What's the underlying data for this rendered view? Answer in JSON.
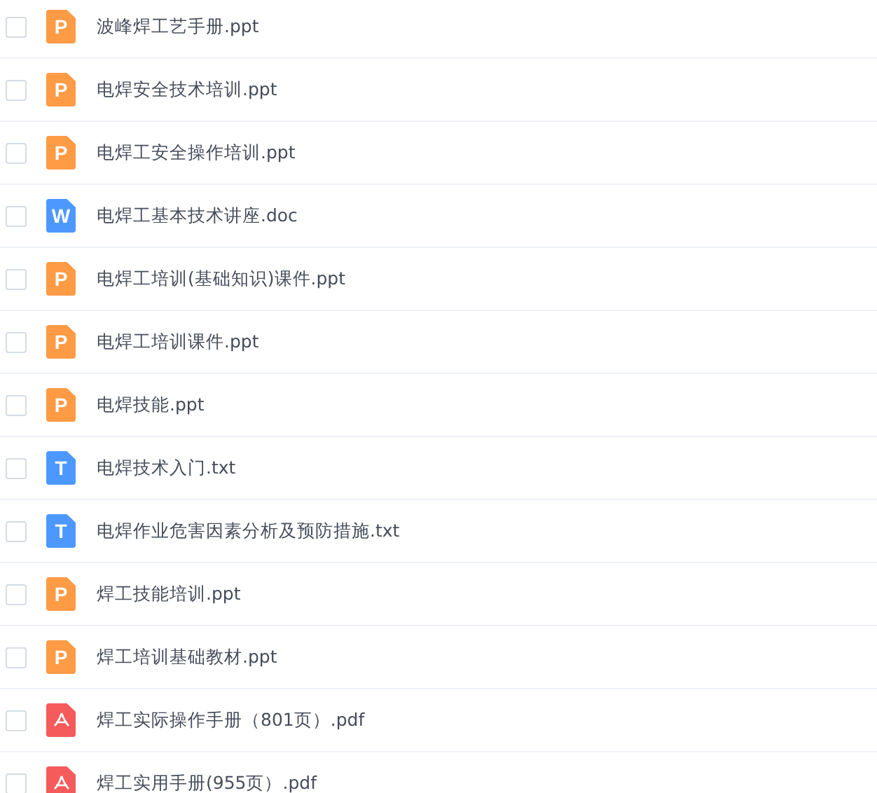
{
  "files": [
    {
      "name": "波峰焊工艺手册.ppt",
      "kind": "ppt",
      "badge": "P",
      "checked": false
    },
    {
      "name": "电焊安全技术培训.ppt",
      "kind": "ppt",
      "badge": "P",
      "checked": false
    },
    {
      "name": "电焊工安全操作培训.ppt",
      "kind": "ppt",
      "badge": "P",
      "checked": false
    },
    {
      "name": "电焊工基本技术讲座.doc",
      "kind": "doc",
      "badge": "W",
      "checked": false
    },
    {
      "name": "电焊工培训(基础知识)课件.ppt",
      "kind": "ppt",
      "badge": "P",
      "checked": false
    },
    {
      "name": "电焊工培训课件.ppt",
      "kind": "ppt",
      "badge": "P",
      "checked": false
    },
    {
      "name": "电焊技能.ppt",
      "kind": "ppt",
      "badge": "P",
      "checked": false
    },
    {
      "name": "电焊技术入门.txt",
      "kind": "txt",
      "badge": "T",
      "checked": false
    },
    {
      "name": "电焊作业危害因素分析及预防措施.txt",
      "kind": "txt",
      "badge": "T",
      "checked": false
    },
    {
      "name": "焊工技能培训.ppt",
      "kind": "ppt",
      "badge": "P",
      "checked": false
    },
    {
      "name": "焊工培训基础教材.ppt",
      "kind": "ppt",
      "badge": "P",
      "checked": false
    },
    {
      "name": "焊工实际操作手册（801页）.pdf",
      "kind": "pdf",
      "checked": false
    },
    {
      "name": "焊工实用手册(955页）.pdf",
      "kind": "pdf",
      "checked": false
    }
  ]
}
